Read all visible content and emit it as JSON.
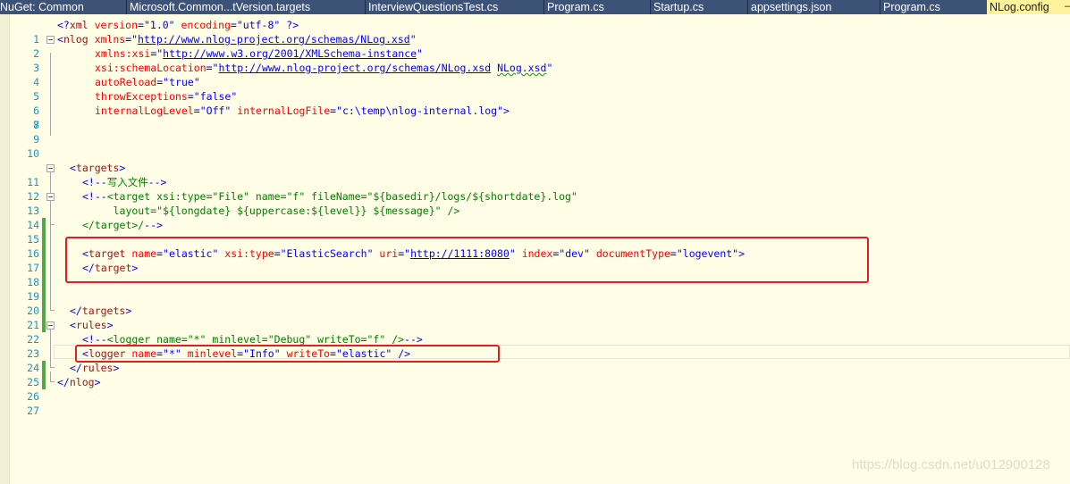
{
  "tabs": [
    {
      "label": "NuGet: Common",
      "active": false
    },
    {
      "label": "Microsoft.Common...tVersion.targets",
      "active": false
    },
    {
      "label": "InterviewQuestionsTest.cs",
      "active": false
    },
    {
      "label": "Program.cs",
      "active": false
    },
    {
      "label": "Startup.cs",
      "active": false
    },
    {
      "label": "appsettings.json",
      "active": false
    },
    {
      "label": "Program.cs",
      "active": false
    },
    {
      "label": "NLog.config",
      "active": true
    }
  ],
  "pin_icon": "pin-icon",
  "lines": [
    {
      "n": "1"
    },
    {
      "n": "2"
    },
    {
      "n": "3"
    },
    {
      "n": "4"
    },
    {
      "n": "5"
    },
    {
      "n": "6"
    },
    {
      "n": "7"
    },
    {
      "n": "8"
    },
    {
      "n": "9"
    },
    {
      "n": "10"
    },
    {
      "n": "11"
    },
    {
      "n": "12"
    },
    {
      "n": "13"
    },
    {
      "n": "14"
    },
    {
      "n": "15"
    },
    {
      "n": "16"
    },
    {
      "n": "17"
    },
    {
      "n": "18"
    },
    {
      "n": "19"
    },
    {
      "n": "20"
    },
    {
      "n": "21"
    },
    {
      "n": "22"
    },
    {
      "n": "23"
    },
    {
      "n": "24"
    },
    {
      "n": "25"
    },
    {
      "n": "26"
    },
    {
      "n": "27"
    }
  ],
  "code": {
    "l1": [
      "<?",
      "xml",
      " version",
      "=\"",
      "1.0",
      "\" ",
      "encoding",
      "=\"",
      "utf-8",
      "\" ",
      "?>"
    ],
    "l2": [
      "<",
      "nlog",
      " xmlns",
      "=\"",
      "http://www.nlog-project.org/schemas/NLog.xsd",
      "\""
    ],
    "l3": [
      "xmlns:xsi",
      "=\"",
      "http://www.w3.org/2001/XMLSchema-instance",
      "\""
    ],
    "l4": [
      "xsi:schemaLocation",
      "=\"",
      "http://www.nlog-project.org/schemas/NLog.xsd",
      " ",
      "NLog.xsd",
      "\""
    ],
    "l5": [
      "autoReload",
      "=\"",
      "true",
      "\""
    ],
    "l6": [
      "throwExceptions",
      "=\"",
      "false",
      "\""
    ],
    "l7": [
      "internalLogLevel",
      "=\"",
      "Off",
      "\" ",
      "internalLogFile",
      "=\"",
      "c:\\temp\\nlog-internal.log",
      "\">"
    ],
    "l11": [
      "<",
      "targets",
      ">"
    ],
    "l12": [
      "<!--",
      "写入文件",
      "-->"
    ],
    "l13": [
      "<!--",
      "<target xsi:type=\"File\" name=\"f\" fileName=\"${basedir}/logs/${shortdate}.log\""
    ],
    "l14": "     layout=\"${longdate} ${uppercase:${level}} ${message}\" />",
    "l15": [
      "</target>/",
      "-->"
    ],
    "l17": [
      "<",
      "target",
      " name",
      "=\"",
      "elastic",
      "\" ",
      "xsi:type",
      "=\"",
      "ElasticSearch",
      "\" ",
      "uri",
      "=\"",
      "http://1111:8080",
      "\" ",
      "index",
      "=\"",
      "dev",
      "\" ",
      "documentType",
      "=\"",
      "logevent",
      "\">"
    ],
    "l18": [
      "</",
      "target",
      ">"
    ],
    "l21": [
      "</",
      "targets",
      ">"
    ],
    "l22": [
      "<",
      "rules",
      ">"
    ],
    "l23": [
      "<!--",
      "<logger name=\"*\" minlevel=\"Debug\" writeTo=\"f\" />",
      "-->"
    ],
    "l24": [
      "<",
      "logger",
      " name",
      "=\"",
      "*",
      "\" ",
      "minlevel",
      "=\"",
      "Info",
      "\" ",
      "writeTo",
      "=\"",
      "elastic",
      "\" />"
    ],
    "l25": [
      "</",
      "rules",
      ">"
    ],
    "l26": [
      "</",
      "nlog",
      ">"
    ]
  },
  "watermark": "https://blog.csdn.net/u012900128",
  "colors": {
    "tab_bar": "#293955",
    "active_tab": "#fff29d",
    "editor_bg": "#fffde6",
    "line_number": "#2b91af",
    "element": "#a31515",
    "attribute": "#ff0000",
    "value": "#0000ff",
    "comment": "#008000",
    "change_bar": "#57a64a",
    "highlight_box": "#e02020"
  }
}
